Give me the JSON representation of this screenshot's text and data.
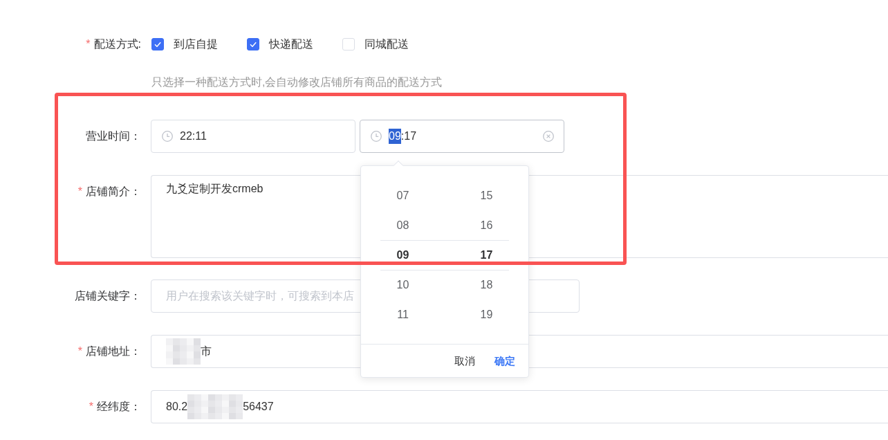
{
  "delivery": {
    "mark": "*",
    "label": "配送方式:",
    "options": [
      {
        "label": "到店自提",
        "checked": true
      },
      {
        "label": "快递配送",
        "checked": true
      },
      {
        "label": "同城配送",
        "checked": false
      }
    ],
    "hint": "只选择一种配送方式时,会自动修改店铺所有商品的配送方式"
  },
  "business_hours": {
    "label": "营业时间：",
    "inputs": [
      {
        "focused": false,
        "value_parts": [
          {
            "text": "22:11",
            "selected": false
          }
        ]
      },
      {
        "focused": true,
        "value_parts": [
          {
            "text": "09",
            "selected": true
          },
          {
            "text": ":17",
            "selected": false
          }
        ]
      }
    ]
  },
  "intro": {
    "mark": "*",
    "label": "店铺简介：",
    "value": "九爻定制开发crmeb"
  },
  "keywords": {
    "label": "店铺关键字：",
    "placeholder": "用户在搜索该关键字时，可搜索到本店"
  },
  "address": {
    "mark": "*",
    "label": "店铺地址：",
    "value_parts": [
      {
        "kind": "mask"
      },
      {
        "kind": "text",
        "text": "市"
      }
    ]
  },
  "coordinates": {
    "mark": "*",
    "label": "经纬度：",
    "value_parts": [
      {
        "kind": "text",
        "text": "80.2"
      },
      {
        "kind": "widemask"
      },
      {
        "kind": "text",
        "text": "56437"
      }
    ]
  },
  "time_picker": {
    "hours": [
      {
        "text": "07",
        "selected": false
      },
      {
        "text": "08",
        "selected": false
      },
      {
        "text": "09",
        "selected": true
      },
      {
        "text": "10",
        "selected": false
      },
      {
        "text": "11",
        "selected": false
      }
    ],
    "minutes": [
      {
        "text": "15",
        "selected": false
      },
      {
        "text": "16",
        "selected": false
      },
      {
        "text": "17",
        "selected": true
      },
      {
        "text": "18",
        "selected": false
      },
      {
        "text": "19",
        "selected": false
      }
    ],
    "buttons": [
      {
        "kind": "cancel",
        "label": "取消"
      },
      {
        "kind": "confirm",
        "label": "确定"
      }
    ]
  },
  "highlight_frame": true
}
